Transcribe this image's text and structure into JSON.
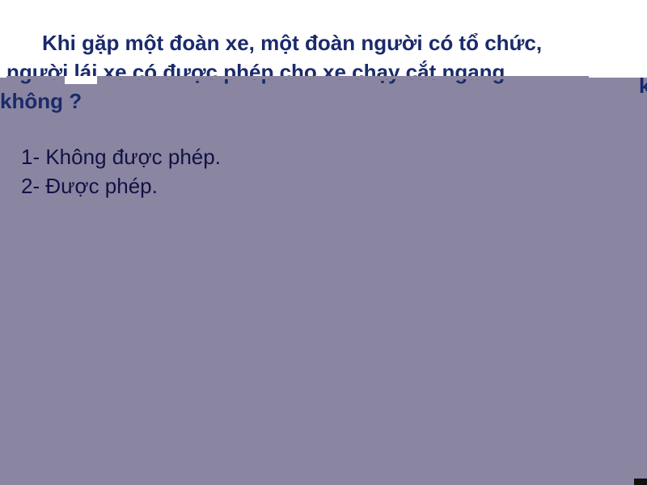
{
  "question": {
    "line1": "Khi gặp một đoàn xe, một đoàn người có tổ chức,",
    "line2": "người lái xe có được phép cho xe chạy cắt ngang",
    "line3": "không ?",
    "stray_fragment": "k"
  },
  "answers": [
    {
      "label": "1- Không được phép."
    },
    {
      "label": "2- Được phép."
    }
  ],
  "colors": {
    "panel": "#8a86a1",
    "question_text": "#1a2a6b",
    "answer_text": "#111144"
  }
}
